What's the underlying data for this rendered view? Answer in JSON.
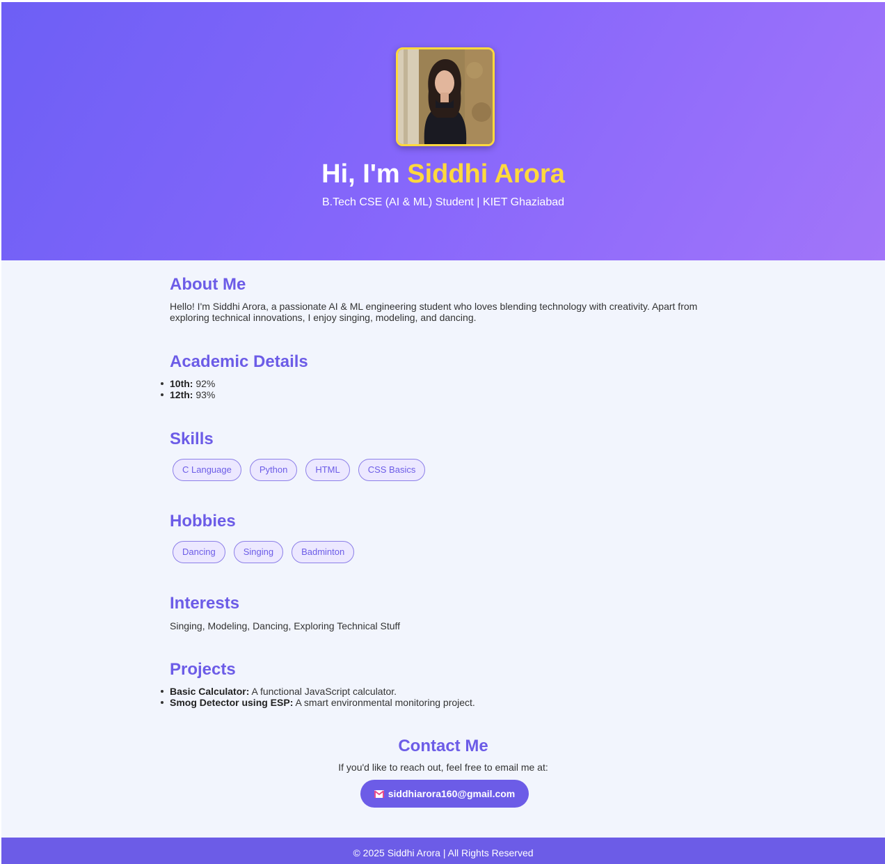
{
  "hero": {
    "title_prefix": "Hi, I'm ",
    "name": "Siddhi Arora",
    "subtitle": "B.Tech CSE (AI & ML) Student | KIET Ghaziabad",
    "accent_color": "#ffd93d"
  },
  "about": {
    "heading": "About Me",
    "text": "Hello! I'm Siddhi Arora, a passionate AI & ML engineering student who loves blending technology with creativity. Apart from exploring technical innovations, I enjoy singing, modeling, and dancing."
  },
  "academic": {
    "heading": "Academic Details",
    "items": [
      {
        "label": "10th:",
        "value": " 92%"
      },
      {
        "label": "12th:",
        "value": " 93%"
      }
    ]
  },
  "skills": {
    "heading": "Skills",
    "tags": [
      "C Language",
      "Python",
      "HTML",
      "CSS Basics"
    ]
  },
  "hobbies": {
    "heading": "Hobbies",
    "tags": [
      "Dancing",
      "Singing",
      "Badminton"
    ]
  },
  "interests": {
    "heading": "Interests",
    "text": "Singing, Modeling, Dancing, Exploring Technical Stuff"
  },
  "projects": {
    "heading": "Projects",
    "items": [
      {
        "label": "Basic Calculator:",
        "value": " A functional JavaScript calculator."
      },
      {
        "label": "Smog Detector using ESP:",
        "value": " A smart environmental monitoring project."
      }
    ]
  },
  "contact": {
    "heading": "Contact Me",
    "text": "If you'd like to reach out, feel free to email me at:",
    "email": "siddhiarora160@gmail.com",
    "email_icon": "mail-icon"
  },
  "footer": {
    "text": "© 2025 Siddhi Arora | All Rights Reserved"
  },
  "colors": {
    "primary": "#6c5ce7",
    "background": "#f2f5fd",
    "hero_gradient_start": "#6d5ff5",
    "hero_gradient_end": "#a275f9"
  }
}
